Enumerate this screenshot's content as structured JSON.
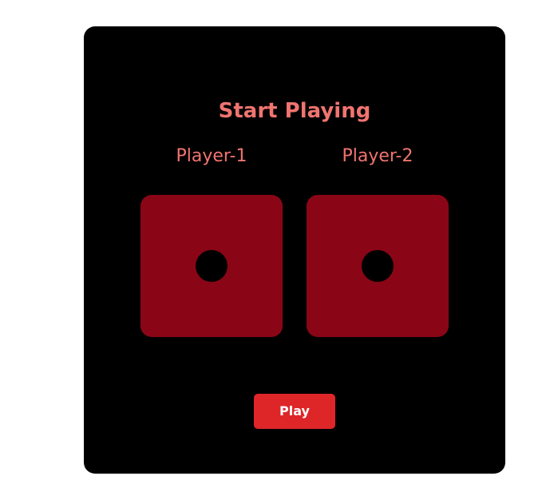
{
  "game": {
    "title": "Start Playing",
    "players": [
      {
        "name": "Player-1",
        "die_value": 1
      },
      {
        "name": "Player-2",
        "die_value": 1
      }
    ],
    "play_label": "Play"
  },
  "colors": {
    "background": "#ffffff",
    "card": "#000000",
    "title_text": "#f07470",
    "die_face": "#8a0616",
    "pip": "#000000",
    "play_button": "#de2628",
    "play_button_text": "#ffffff"
  },
  "icons": {
    "die": "die-face-one-icon"
  }
}
